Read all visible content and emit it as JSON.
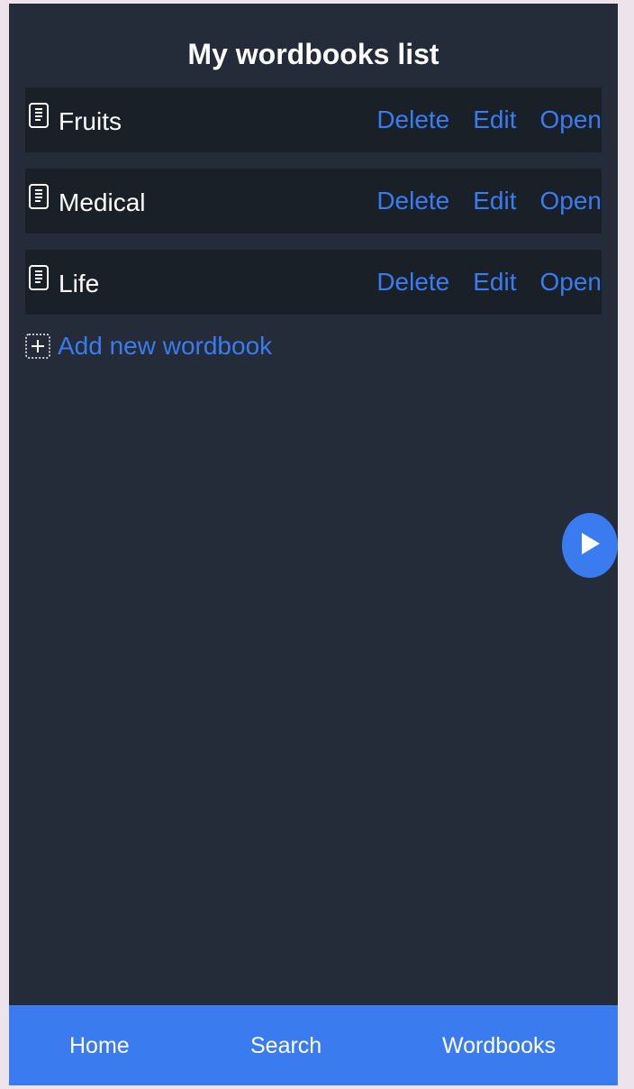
{
  "header": {
    "title": "My wordbooks list"
  },
  "wordbooks": [
    {
      "name": "Fruits",
      "icon": "document-icon",
      "actions": {
        "delete": "Delete",
        "edit": "Edit",
        "open": "Open"
      }
    },
    {
      "name": "Medical",
      "icon": "document-icon",
      "actions": {
        "delete": "Delete",
        "edit": "Edit",
        "open": "Open"
      }
    },
    {
      "name": "Life",
      "icon": "document-icon",
      "actions": {
        "delete": "Delete",
        "edit": "Edit",
        "open": "Open"
      }
    }
  ],
  "add_wordbook": {
    "label": "Add new wordbook",
    "icon": "plus-box-icon"
  },
  "fab": {
    "icon": "play-icon"
  },
  "bottom_nav": {
    "items": [
      "Home",
      "Search",
      "Wordbooks"
    ]
  },
  "colors": {
    "background": "#232c38",
    "row_background": "#1a2028",
    "accent": "#3a7cf0",
    "text": "#ffffff"
  }
}
